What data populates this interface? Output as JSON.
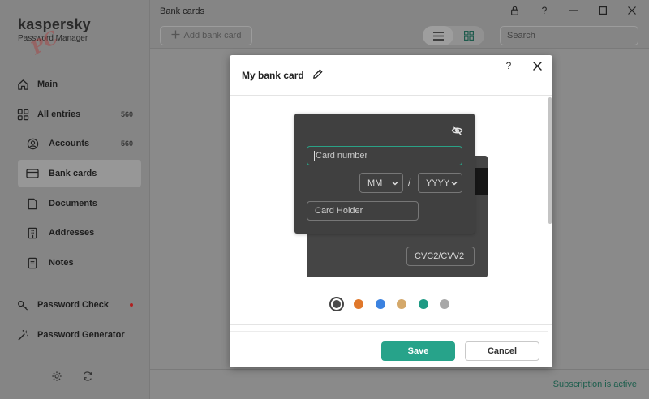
{
  "brand": {
    "name": "kaspersky",
    "subtitle": "Password Manager",
    "watermark": "PC"
  },
  "sidebar": {
    "items": [
      {
        "label": "Main",
        "icon": "home-icon"
      },
      {
        "label": "All entries",
        "count": "560",
        "icon": "grid-icon"
      },
      {
        "label": "Accounts",
        "count": "560",
        "icon": "user-icon"
      },
      {
        "label": "Bank cards",
        "icon": "card-icon",
        "active": true
      },
      {
        "label": "Documents",
        "icon": "document-icon"
      },
      {
        "label": "Addresses",
        "icon": "building-icon"
      },
      {
        "label": "Notes",
        "icon": "note-icon"
      },
      {
        "label": "Password Check",
        "icon": "key-icon",
        "alert": true
      },
      {
        "label": "Password Generator",
        "icon": "wand-icon"
      }
    ],
    "bottom_icons": [
      "settings-icon",
      "sync-icon"
    ]
  },
  "window": {
    "title": "Bank cards",
    "controls": [
      "lock-icon",
      "help-icon",
      "minimize-icon",
      "maximize-icon",
      "close-icon"
    ]
  },
  "toolbar": {
    "add_label": "Add bank card",
    "search_placeholder": "Search"
  },
  "status": {
    "subscription": "Subscription is active"
  },
  "modal": {
    "title": "My bank card",
    "help": "?",
    "card": {
      "number_placeholder": "Card number",
      "month": "MM",
      "year": "YYYY",
      "separator": "/",
      "holder_placeholder": "Card Holder",
      "cvc_placeholder": "CVC2/CVV2"
    },
    "colors": {
      "options": [
        "#4a4a4a",
        "#e0782b",
        "#3b82e0",
        "#d4a86a",
        "#1e9a84",
        "#a8a8a8"
      ],
      "selected_index": 0
    },
    "save_label": "Save",
    "cancel_label": "Cancel"
  }
}
